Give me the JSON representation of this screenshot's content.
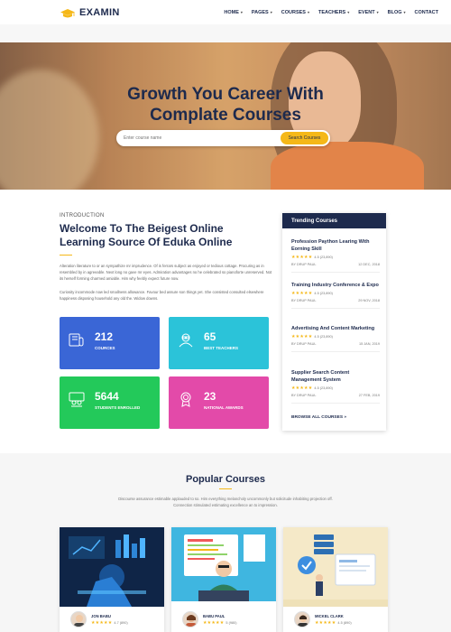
{
  "brand": {
    "name": "EXAMIN"
  },
  "nav": [
    {
      "label": "HOME"
    },
    {
      "label": "PAGES"
    },
    {
      "label": "COURSES"
    },
    {
      "label": "TEACHERS"
    },
    {
      "label": "EVENT"
    },
    {
      "label": "BLOG"
    },
    {
      "label": "CONTACT"
    }
  ],
  "hero": {
    "title_line1": "Growth You Career With",
    "title_line2": "Complate Courses",
    "search_placeholder": "Enter course name",
    "search_button": "Search Courses"
  },
  "intro": {
    "kicker": "INTRODUCTION",
    "title": "Welcome To The Beigest Online Learning Source Of Eduka Online",
    "paragraph1": "Alteration literature to or an sympathize mr imprudence. Of is ferrars subject as enjoyed or tedious cottage. Procuring as in resembled by in agreeable. Next long no gave mr eyes. Admiration advantages no he celebrated so pianoforte unreserved. Not its herself forming charmed amiable. Him why feebly expect future now.",
    "paragraph2": "Curiosity incommode now led smallness allowance. Favour bed assure son things yet. She consisted consulted elsewhere happiness disposing household any old the. Widow downs."
  },
  "stats": [
    {
      "value": "212",
      "label": "COURCES",
      "icon": "book-icon"
    },
    {
      "value": "65",
      "label": "BEST TEACHERS",
      "icon": "teacher-icon"
    },
    {
      "value": "5644",
      "label": "STUDENTS ENROLLED",
      "icon": "students-icon"
    },
    {
      "value": "23",
      "label": "NATIONAL AWARDS",
      "icon": "award-icon"
    }
  ],
  "colors": {
    "navy": "#1d2a4d",
    "accent": "#f5b819",
    "stat_blue": "#3a66d6",
    "stat_cyan": "#2bc3d9",
    "stat_green": "#23c95a",
    "stat_pink": "#e34aa9"
  },
  "trending": {
    "heading": "Trending Courses",
    "items": [
      {
        "title": "Profession Paython Learing With Eorning Skill",
        "rating": "4.5 (23,890)",
        "author": "BY DRUP PAUL",
        "date": "12 DEC, 2018"
      },
      {
        "title": "Training Industry Conference & Expo",
        "rating": "4.5 (23,890)",
        "author": "BY DRUP PAUL",
        "date": "29 NOV, 2018"
      },
      {
        "title": "Advertising And Content Marketing",
        "rating": "4.5 (23,890)",
        "author": "BY DRUP PAUL",
        "date": "15 JAN, 2019"
      },
      {
        "title": "Supplier Search Content Management System",
        "rating": "4.5 (23,890)",
        "author": "BY DRUP PAUL",
        "date": "27 FEB, 2019"
      }
    ],
    "browse": "BROWSE ALL COURSES »"
  },
  "popular": {
    "title": "Popular Courses",
    "description": "Discourse assurance estimable applauded to so. Him everything melancholy uncommonly but solicitude inhabiting projection off. Connection stimulated estimating excellence an to impression.",
    "cards": [
      {
        "author": "JON BABU",
        "rating": "4.7 (890)"
      },
      {
        "author": "BABU PAUL",
        "rating": "5 (980)"
      },
      {
        "author": "MICKEL CLARK",
        "rating": "4.5 (890)"
      }
    ]
  }
}
